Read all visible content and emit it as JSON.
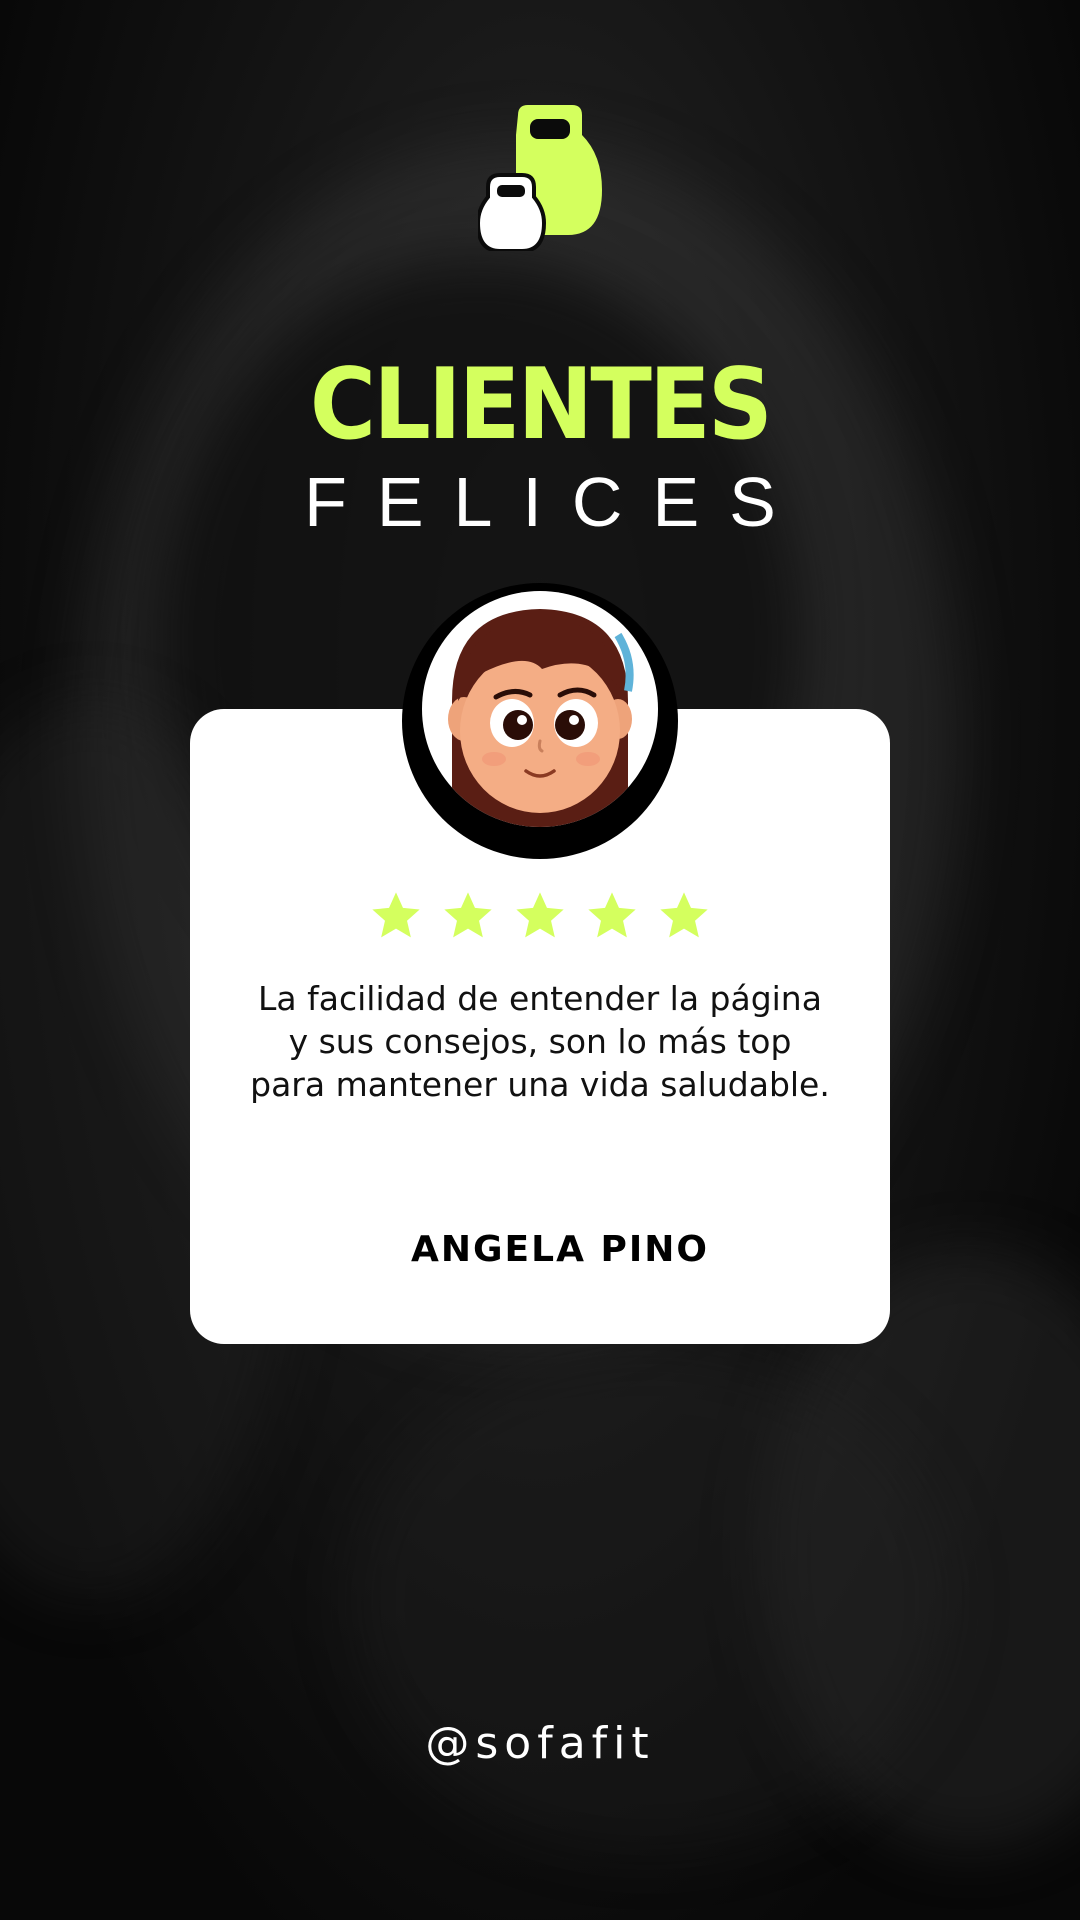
{
  "header": {
    "title_main": "CLIENTES",
    "title_sub": "FELICES"
  },
  "logo": {
    "icon": "kettlebell-icon",
    "accent_color": "#d4ff5e",
    "secondary_color": "#ffffff"
  },
  "testimonial": {
    "avatar_icon": "woman-avatar-icon",
    "rating": 5,
    "rating_max": 5,
    "star_color": "#d4ff5e",
    "quote": "La facilidad de entender la página y sus consejos, son lo más top para mantener una vida saludable.",
    "author": "ANGELA PINO"
  },
  "footer": {
    "handle": "@sofafit"
  },
  "colors": {
    "accent": "#d4ff5e",
    "background": "#0b0b0b",
    "card": "#ffffff"
  }
}
